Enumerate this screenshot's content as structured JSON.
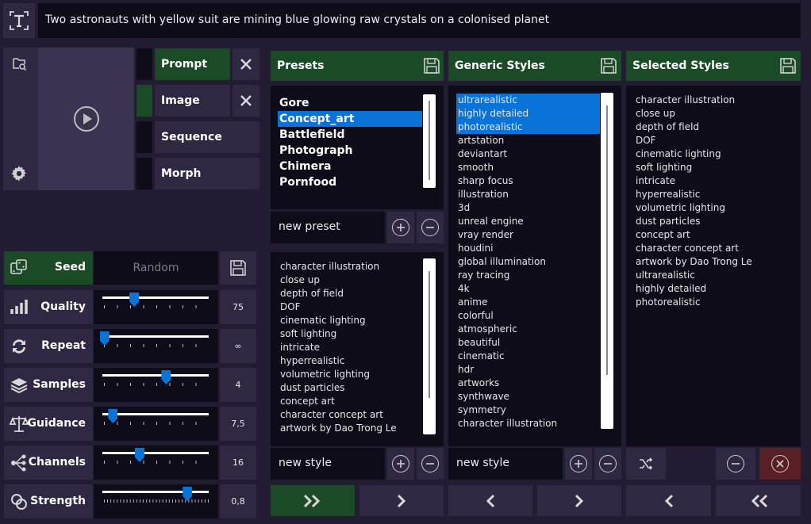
{
  "prompt": {
    "text": "Two astronauts with yellow suit are mining blue glowing raw crystals on a colonised planet"
  },
  "modes": [
    {
      "label": "Prompt",
      "active": true,
      "closable": true
    },
    {
      "label": "Image",
      "active": false,
      "closable": true
    },
    {
      "label": "Sequence",
      "active": false,
      "closable": false
    },
    {
      "label": "Morph",
      "active": false,
      "closable": false
    }
  ],
  "seed": {
    "label": "Seed",
    "placeholder": "Random"
  },
  "params": [
    {
      "label": "Quality",
      "value": "75",
      "level": 0.3
    },
    {
      "label": "Repeat",
      "value": "∞",
      "level": 0.02
    },
    {
      "label": "Samples",
      "value": "4",
      "level": 0.6
    },
    {
      "label": "Guidance",
      "value": "7,5",
      "level": 0.1
    },
    {
      "label": "Channels",
      "value": "16",
      "level": 0.35
    },
    {
      "label": "Strength",
      "value": "0,8",
      "level": 0.8
    }
  ],
  "presets": {
    "title": "Presets",
    "items": [
      "Gore",
      "Concept_art",
      "Battlefield",
      "Photograph",
      "Chimera",
      "Pornfood"
    ],
    "selected": "Concept_art",
    "new_value": "new preset",
    "styles": [
      "character illustration",
      "close up",
      "depth of field",
      "DOF",
      "cinematic lighting",
      "soft lighting",
      "intricate",
      "hyperrealistic",
      "volumetric lighting",
      "dust particles",
      "concept art",
      "character concept art",
      "artwork by Dao Trong Le"
    ],
    "new_style": "new style"
  },
  "generic": {
    "title": "Generic Styles",
    "items": [
      "ultrarealistic",
      "highly detailed",
      "photorealistic",
      "artstation",
      "deviantart",
      "smooth",
      "sharp focus",
      "illustration",
      "3d",
      "unreal engine",
      "vray render",
      "houdini",
      "global illumination",
      "ray tracing",
      "4k",
      "anime",
      "colorful",
      "atmospheric",
      "beautiful",
      "cinematic",
      "hdr",
      "artworks",
      "synthwave",
      "symmetry",
      "character illustration"
    ],
    "selected_count": 3,
    "new_style": "new style"
  },
  "selected_styles": {
    "title": "Selected Styles",
    "items": [
      "character illustration",
      "close up",
      "depth of field",
      "DOF",
      "cinematic lighting",
      "soft lighting",
      "intricate",
      "hyperrealistic",
      "volumetric lighting",
      "dust particles",
      "concept art",
      "character concept art",
      "artwork by Dao Trong Le",
      "ultrarealistic",
      "highly detailed",
      "photorealistic"
    ]
  },
  "colors": {
    "background": "#221c33",
    "panel_dark": "#0f0c19",
    "button": "#2e2842",
    "header_green": "#1b4a26",
    "selection_blue": "#0a73d8",
    "danger_red": "#5a1f24"
  }
}
